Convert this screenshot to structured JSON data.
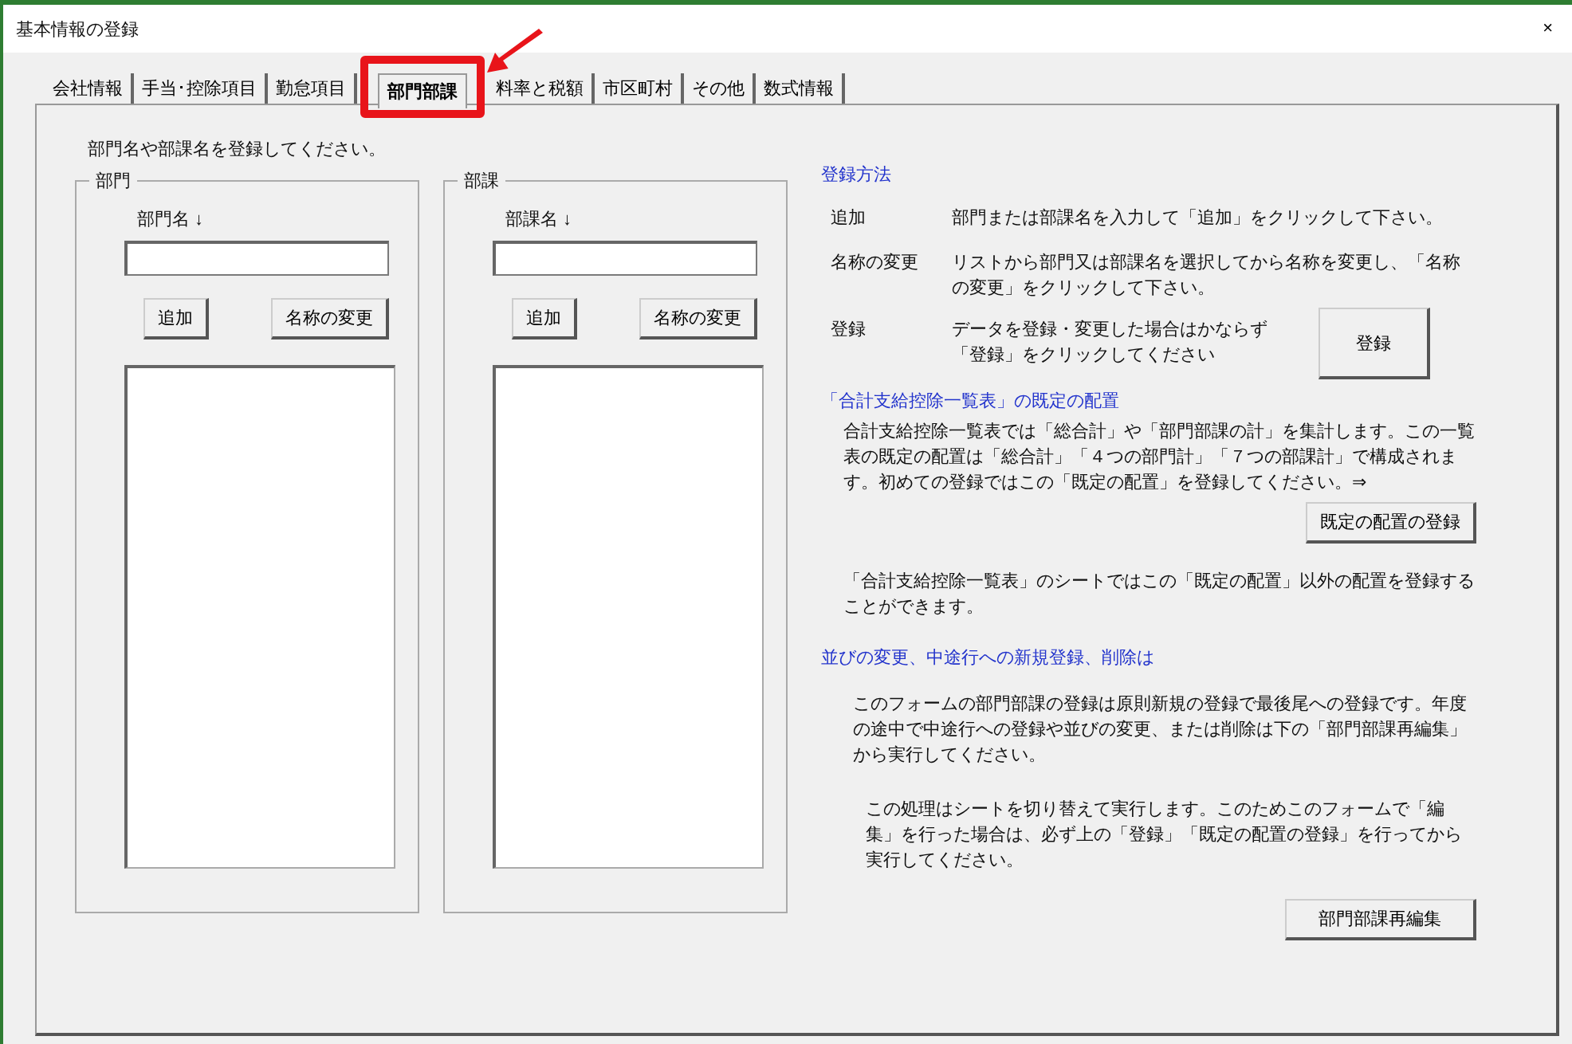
{
  "window": {
    "title": "基本情報の登録",
    "close": "×"
  },
  "tabs": [
    {
      "label": "会社情報",
      "selected": false
    },
    {
      "label": "手当･控除項目",
      "selected": false
    },
    {
      "label": "勤怠項目",
      "selected": false
    },
    {
      "label": "部門部課",
      "selected": true
    },
    {
      "label": "料率と税額",
      "selected": false
    },
    {
      "label": "市区町村",
      "selected": false
    },
    {
      "label": "その他",
      "selected": false
    },
    {
      "label": "数式情報",
      "selected": false
    }
  ],
  "instruction": "部門名や部課名を登録してください。",
  "groups": [
    {
      "title": "部門",
      "field_label": "部門名 ↓",
      "add_button": "追加",
      "rename_button": "名称の変更"
    },
    {
      "title": "部課",
      "field_label": "部課名 ↓",
      "add_button": "追加",
      "rename_button": "名称の変更"
    }
  ],
  "how_to": {
    "heading": "登録方法",
    "rows": [
      {
        "term": "追加",
        "description": "部門または部課名を入力して「追加」をクリックして下さい。"
      },
      {
        "term": "名称の変更",
        "description": "リストから部門又は部課名を選択してから名称を変更し、「名称の変更」をクリックして下さい。"
      },
      {
        "term": "登録",
        "description": "データを登録・変更した場合はかならず「登録」をクリックしてください"
      }
    ],
    "button": "登録"
  },
  "default_layout": {
    "heading": "「合計支給控除一覧表」の既定の配置",
    "paragraph": "合計支給控除一覧表では「総合計」や「部門部課の計」を集計します。この一覧表の既定の配置は「総合計」「４つの部門計」「７つの部課計」で構成されます。初めての登録ではこの「既定の配置」を登録してください。⇒",
    "button": "既定の配置の登録",
    "note": "「合計支給控除一覧表」のシートではこの「既定の配置」以外の配置を登録することができます。"
  },
  "reorder": {
    "heading": "並びの変更、中途行への新規登録、削除は",
    "paragraph": "このフォームの部門部課の登録は原則新規の登録で最後尾への登録です。年度の途中で中途行への登録や並びの変更、または削除は下の「部門部課再編集」から実行してください。",
    "note": "この処理はシートを切り替えて実行します。このためこのフォームで「編集」を行った場合は、必ず上の「登録」「既定の配置の登録」を行ってから実行してください。",
    "button": "部門部課再編集"
  }
}
